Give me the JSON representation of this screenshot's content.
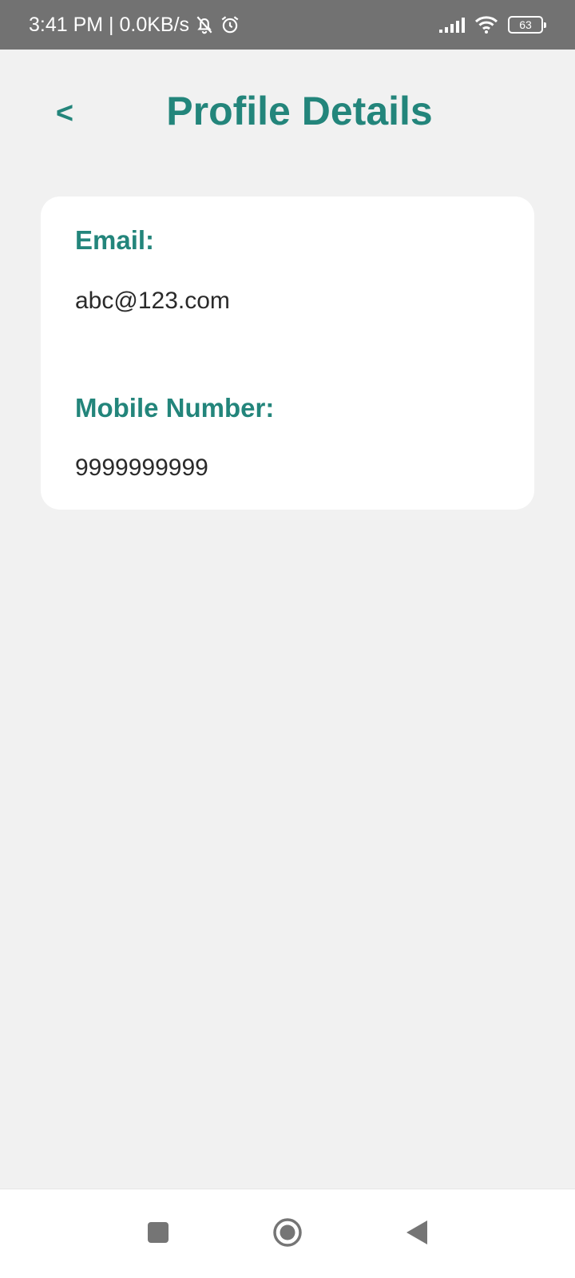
{
  "status_bar": {
    "time_and_speed": "3:41 PM | 0.0KB/s",
    "battery_level": "63"
  },
  "header": {
    "back_label": "<",
    "title": "Profile Details"
  },
  "profile": {
    "email_label": "Email:",
    "email_value": "abc@123.com",
    "mobile_label": "Mobile Number:",
    "mobile_value": "9999999999"
  },
  "theme": {
    "accent": "#23857b",
    "background": "#f1f1f1",
    "card": "#ffffff",
    "status_bar": "#727272"
  },
  "icons": {
    "status": [
      "muted-bell-icon",
      "alarm-icon",
      "signal-icon",
      "wifi-icon",
      "battery-icon"
    ],
    "navigation": [
      "recents-icon",
      "home-icon",
      "back-icon"
    ]
  }
}
